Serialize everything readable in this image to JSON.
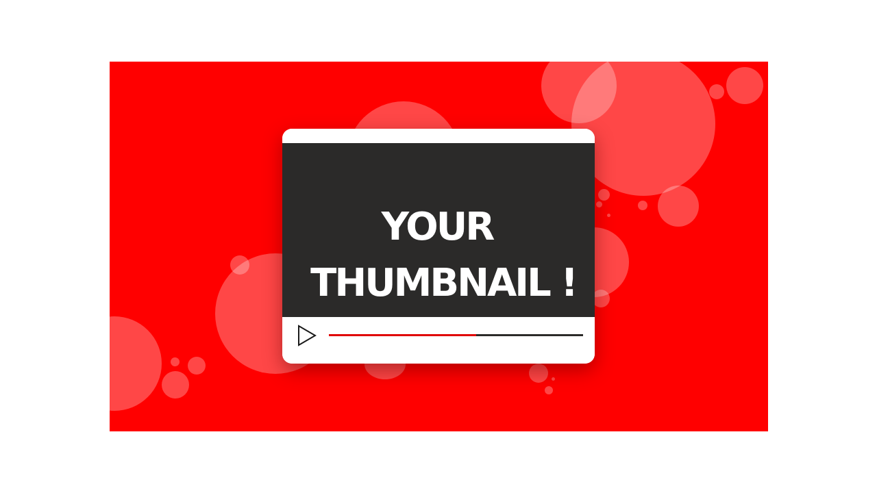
{
  "thumbnail": {
    "title_line_1": "YOUR",
    "title_line_2": "THUMBNAIL !"
  },
  "player": {
    "play_icon": "play-icon",
    "progress": 0.58
  },
  "colors": {
    "background": "#ff0000",
    "screen": "#2b2a29",
    "progress_played": "#e00000",
    "progress_remaining": "#2b2a29",
    "bubbles": "#ff5a5a"
  }
}
